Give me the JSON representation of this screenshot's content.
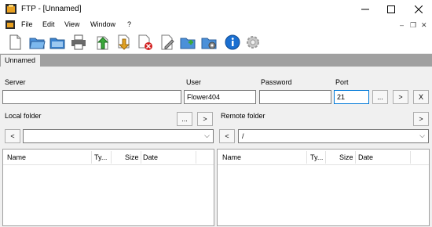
{
  "window": {
    "title": "FTP - [Unnamed]"
  },
  "menu": {
    "items": [
      "File",
      "Edit",
      "View",
      "Window",
      "?"
    ]
  },
  "tabs": [
    {
      "label": "Unnamed"
    }
  ],
  "connection": {
    "server_label": "Server",
    "server_value": "",
    "user_label": "User",
    "user_value": "Flower404",
    "password_label": "Password",
    "password_value": "",
    "port_label": "Port",
    "port_value": "21",
    "more_button": "...",
    "connect_button": ">",
    "close_button": "X"
  },
  "local": {
    "label": "Local folder",
    "browse_button": "...",
    "go_button": ">",
    "back_button": "<",
    "path": ""
  },
  "remote": {
    "label": "Remote folder",
    "go_button": ">",
    "back_button": "<",
    "path": "/"
  },
  "local_list": {
    "columns": [
      "Name",
      "Ty...",
      "Size",
      "Date"
    ]
  },
  "remote_list": {
    "columns": [
      "Name",
      "Ty...",
      "Size",
      "Date"
    ]
  },
  "icons": [
    "new-file-icon",
    "open-folder-icon",
    "save-icon",
    "print-icon",
    "upload-icon",
    "download-icon",
    "delete-icon",
    "rename-icon",
    "new-folder-icon",
    "properties-icon",
    "info-icon",
    "settings-icon"
  ],
  "colors": {
    "tabbar": "#a0a0a0",
    "info": "#1a6fd1",
    "upload": "#3aa83a",
    "download": "#e0a020",
    "delete": "#d32020"
  }
}
